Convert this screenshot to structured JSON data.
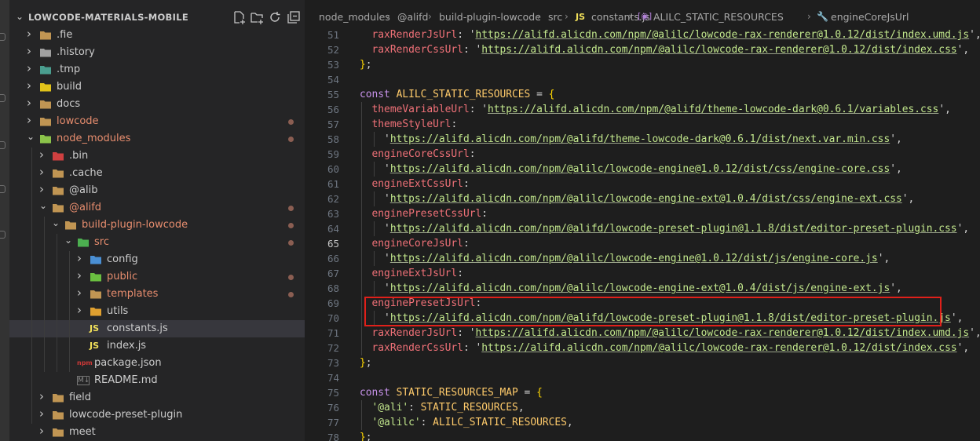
{
  "explorer": {
    "root_title": "LOWCODE-MATERIALS-MOBILE",
    "items": [
      {
        "label": ".fie",
        "modified": false
      },
      {
        "label": ".history",
        "modified": false
      },
      {
        "label": ".tmp",
        "modified": false
      },
      {
        "label": "build",
        "modified": false
      },
      {
        "label": "docs",
        "modified": false
      },
      {
        "label": "lowcode",
        "modified": true
      },
      {
        "label": "node_modules",
        "modified": true
      },
      {
        "label": ".bin",
        "modified": false
      },
      {
        "label": ".cache",
        "modified": false
      },
      {
        "label": "@alib",
        "modified": false
      },
      {
        "label": "@alifd",
        "modified": true
      },
      {
        "label": "build-plugin-lowcode",
        "modified": true
      },
      {
        "label": "src",
        "modified": true
      },
      {
        "label": "config",
        "modified": false
      },
      {
        "label": "public",
        "modified": true
      },
      {
        "label": "templates",
        "modified": true
      },
      {
        "label": "utils",
        "modified": false
      },
      {
        "label": "constants.js",
        "modified": false,
        "icon_text": "JS"
      },
      {
        "label": "index.js",
        "modified": false,
        "icon_text": "JS"
      },
      {
        "label": "package.json",
        "modified": false,
        "icon_text": "npm"
      },
      {
        "label": "README.md",
        "modified": false,
        "icon_text": "M↓"
      },
      {
        "label": "field",
        "modified": false
      },
      {
        "label": "lowcode-preset-plugin",
        "modified": false
      },
      {
        "label": "meet",
        "modified": false
      }
    ]
  },
  "breadcrumb": {
    "items": [
      "node_modules",
      "@alifd",
      "build-plugin-lowcode",
      "src",
      "constants.js",
      "ALILC_STATIC_RESOURCES",
      "engineCoreJsUrl"
    ],
    "js_badge": "JS"
  },
  "code": {
    "active_line": 65,
    "lines": [
      {
        "n": 51,
        "tokens": [
          [
            "i",
            "  "
          ],
          [
            "key",
            "raxRenderJsUrl"
          ],
          [
            "p",
            ": '"
          ],
          [
            "url",
            "https://alifd.alicdn.com/npm/@alilc/lowcode-rax-renderer@1.0.12/dist/index.umd.js"
          ],
          [
            "p",
            "',"
          ]
        ]
      },
      {
        "n": 52,
        "tokens": [
          [
            "i",
            "  "
          ],
          [
            "key",
            "raxRenderCssUrl"
          ],
          [
            "p",
            ": '"
          ],
          [
            "url",
            "https://alifd.alicdn.com/npm/@alilc/lowcode-rax-renderer@1.0.12/dist/index.css"
          ],
          [
            "p",
            "',"
          ]
        ]
      },
      {
        "n": 53,
        "tokens": [
          [
            "brace",
            "}"
          ],
          [
            "p",
            ";"
          ]
        ]
      },
      {
        "n": 54,
        "tokens": []
      },
      {
        "n": 55,
        "tokens": [
          [
            "kw",
            "const "
          ],
          [
            "const",
            "ALILC_STATIC_RESOURCES"
          ],
          [
            "p",
            " = "
          ],
          [
            "brace",
            "{"
          ]
        ]
      },
      {
        "n": 56,
        "tokens": [
          [
            "i",
            "  "
          ],
          [
            "key",
            "themeVariableUrl"
          ],
          [
            "p",
            ": '"
          ],
          [
            "url",
            "https://alifd.alicdn.com/npm/@alifd/theme-lowcode-dark@0.6.1/variables.css"
          ],
          [
            "p",
            "',"
          ]
        ]
      },
      {
        "n": 57,
        "tokens": [
          [
            "i",
            "  "
          ],
          [
            "key",
            "themeStyleUrl"
          ],
          [
            "p",
            ":"
          ]
        ]
      },
      {
        "n": 58,
        "tokens": [
          [
            "i",
            "    "
          ],
          [
            "p",
            "'"
          ],
          [
            "url",
            "https://alifd.alicdn.com/npm/@alifd/theme-lowcode-dark@0.6.1/dist/next.var.min.css"
          ],
          [
            "p",
            "',"
          ]
        ]
      },
      {
        "n": 59,
        "tokens": [
          [
            "i",
            "  "
          ],
          [
            "key",
            "engineCoreCssUrl"
          ],
          [
            "p",
            ":"
          ]
        ]
      },
      {
        "n": 60,
        "tokens": [
          [
            "i",
            "    "
          ],
          [
            "p",
            "'"
          ],
          [
            "url",
            "https://alifd.alicdn.com/npm/@alilc/lowcode-engine@1.0.12/dist/css/engine-core.css"
          ],
          [
            "p",
            "',"
          ]
        ]
      },
      {
        "n": 61,
        "tokens": [
          [
            "i",
            "  "
          ],
          [
            "key",
            "engineExtCssUrl"
          ],
          [
            "p",
            ":"
          ]
        ]
      },
      {
        "n": 62,
        "tokens": [
          [
            "i",
            "    "
          ],
          [
            "p",
            "'"
          ],
          [
            "url",
            "https://alifd.alicdn.com/npm/@alilc/lowcode-engine-ext@1.0.4/dist/css/engine-ext.css"
          ],
          [
            "p",
            "',"
          ]
        ]
      },
      {
        "n": 63,
        "tokens": [
          [
            "i",
            "  "
          ],
          [
            "key",
            "enginePresetCssUrl"
          ],
          [
            "p",
            ":"
          ]
        ]
      },
      {
        "n": 64,
        "tokens": [
          [
            "i",
            "    "
          ],
          [
            "p",
            "'"
          ],
          [
            "url",
            "https://alifd.alicdn.com/npm/@alifd/lowcode-preset-plugin@1.1.8/dist/editor-preset-plugin.css"
          ],
          [
            "p",
            "',"
          ]
        ]
      },
      {
        "n": 65,
        "tokens": [
          [
            "i",
            "  "
          ],
          [
            "key",
            "engineCoreJsUrl"
          ],
          [
            "p",
            ":"
          ]
        ]
      },
      {
        "n": 66,
        "tokens": [
          [
            "i",
            "    "
          ],
          [
            "p",
            "'"
          ],
          [
            "url",
            "https://alifd.alicdn.com/npm/@alilc/lowcode-engine@1.0.12/dist/js/engine-core.js"
          ],
          [
            "p",
            "',"
          ]
        ]
      },
      {
        "n": 67,
        "tokens": [
          [
            "i",
            "  "
          ],
          [
            "key",
            "engineExtJsUrl"
          ],
          [
            "p",
            ":"
          ]
        ]
      },
      {
        "n": 68,
        "tokens": [
          [
            "i",
            "    "
          ],
          [
            "p",
            "'"
          ],
          [
            "url",
            "https://alifd.alicdn.com/npm/@alilc/lowcode-engine-ext@1.0.4/dist/js/engine-ext.js"
          ],
          [
            "p",
            "',"
          ]
        ]
      },
      {
        "n": 69,
        "tokens": [
          [
            "i",
            "  "
          ],
          [
            "key",
            "enginePresetJsUrl"
          ],
          [
            "p",
            ":"
          ]
        ]
      },
      {
        "n": 70,
        "tokens": [
          [
            "i",
            "    "
          ],
          [
            "p",
            "'"
          ],
          [
            "url",
            "https://alifd.alicdn.com/npm/@alifd/lowcode-preset-plugin@1.1.8/dist/editor-preset-plugin.js"
          ],
          [
            "p",
            "',"
          ]
        ]
      },
      {
        "n": 71,
        "tokens": [
          [
            "i",
            "  "
          ],
          [
            "key",
            "raxRenderJsUrl"
          ],
          [
            "p",
            ": '"
          ],
          [
            "url",
            "https://alifd.alicdn.com/npm/@alilc/lowcode-rax-renderer@1.0.12/dist/index.umd.js"
          ],
          [
            "p",
            "',"
          ]
        ]
      },
      {
        "n": 72,
        "tokens": [
          [
            "i",
            "  "
          ],
          [
            "key",
            "raxRenderCssUrl"
          ],
          [
            "p",
            ": '"
          ],
          [
            "url",
            "https://alifd.alicdn.com/npm/@alilc/lowcode-rax-renderer@1.0.12/dist/index.css"
          ],
          [
            "p",
            "',"
          ]
        ]
      },
      {
        "n": 73,
        "tokens": [
          [
            "brace",
            "}"
          ],
          [
            "p",
            ";"
          ]
        ]
      },
      {
        "n": 74,
        "tokens": []
      },
      {
        "n": 75,
        "tokens": [
          [
            "kw",
            "const "
          ],
          [
            "const",
            "STATIC_RESOURCES_MAP"
          ],
          [
            "p",
            " = "
          ],
          [
            "brace",
            "{"
          ]
        ]
      },
      {
        "n": 76,
        "tokens": [
          [
            "i",
            "  "
          ],
          [
            "str",
            "'@ali'"
          ],
          [
            "p",
            ": "
          ],
          [
            "const",
            "STATIC_RESOURCES"
          ],
          [
            "p",
            ","
          ]
        ]
      },
      {
        "n": 77,
        "tokens": [
          [
            "i",
            "  "
          ],
          [
            "str",
            "'@alilc'"
          ],
          [
            "p",
            ": "
          ],
          [
            "const",
            "ALILC_STATIC_RESOURCES"
          ],
          [
            "p",
            ","
          ]
        ]
      },
      {
        "n": 78,
        "tokens": [
          [
            "brace",
            "}"
          ],
          [
            "p",
            ";"
          ]
        ]
      }
    ]
  },
  "colors": {
    "editor_bg": "#1e1e1e",
    "sidebar_bg": "#252526",
    "modified_label": "#e78d6e",
    "highlight_box": "#e0201a"
  }
}
